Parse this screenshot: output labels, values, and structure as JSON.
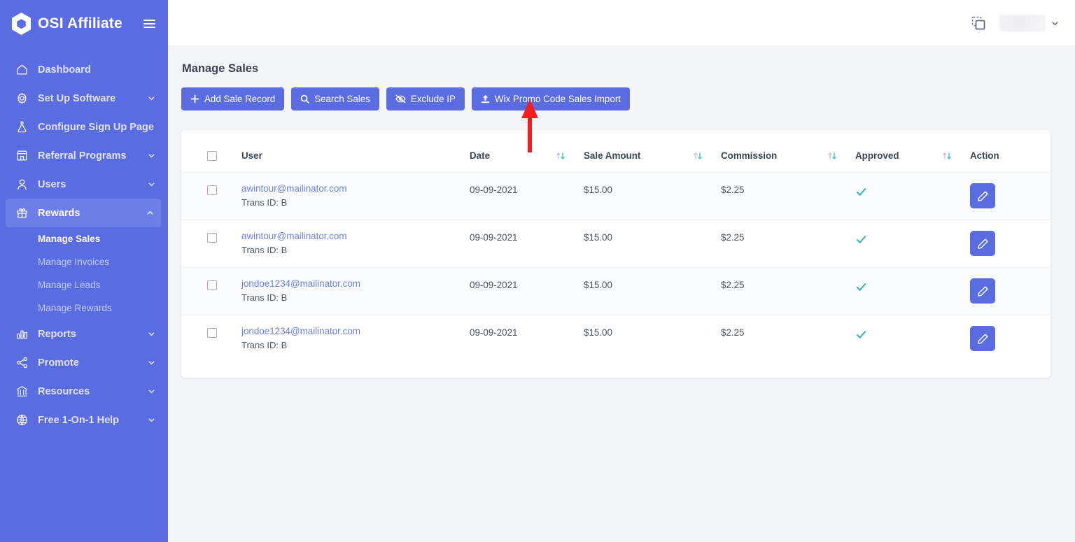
{
  "brand": {
    "name": "OSI Affiliate",
    "logo_icon": "hexagon-logo-icon",
    "menu_icon": "hamburger-menu-icon"
  },
  "sidebar": {
    "items": [
      {
        "label": "Dashboard",
        "icon": "home-icon",
        "expandable": false,
        "active": false
      },
      {
        "label": "Set Up Software",
        "icon": "gear-icon",
        "expandable": true,
        "active": false
      },
      {
        "label": "Configure Sign Up Page",
        "icon": "flask-icon",
        "expandable": false,
        "active": false
      },
      {
        "label": "Referral Programs",
        "icon": "store-icon",
        "expandable": true,
        "active": false
      },
      {
        "label": "Users",
        "icon": "person-icon",
        "expandable": true,
        "active": false
      },
      {
        "label": "Rewards",
        "icon": "gift-icon",
        "expandable": true,
        "active": true
      }
    ],
    "sub_items": [
      {
        "label": "Manage Sales",
        "current": true
      },
      {
        "label": "Manage Invoices",
        "current": false
      },
      {
        "label": "Manage Leads",
        "current": false
      },
      {
        "label": "Manage Rewards",
        "current": false
      }
    ],
    "items_after": [
      {
        "label": "Reports",
        "icon": "bar-chart-icon",
        "expandable": true
      },
      {
        "label": "Promote",
        "icon": "share-nodes-icon",
        "expandable": true
      },
      {
        "label": "Resources",
        "icon": "bank-icon",
        "expandable": true
      },
      {
        "label": "Free 1-On-1 Help",
        "icon": "globe-icon",
        "expandable": true
      }
    ]
  },
  "topbar": {
    "duplicate_icon": "copy-duplicate-icon",
    "avatar": "user-avatar",
    "chevron_icon": "chevron-down-icon"
  },
  "main": {
    "page_title": "Manage Sales",
    "toolbar": [
      {
        "label": "Add Sale Record",
        "icon": "plus-icon"
      },
      {
        "label": "Search Sales",
        "icon": "search-icon"
      },
      {
        "label": "Exclude IP",
        "icon": "eye-slash-icon"
      },
      {
        "label": "Wix Promo Code Sales Import",
        "icon": "upload-icon"
      }
    ],
    "table": {
      "columns": [
        {
          "label": "",
          "sortable": false
        },
        {
          "label": "User",
          "sortable": false
        },
        {
          "label": "Date",
          "sortable": true
        },
        {
          "label": "Sale Amount",
          "sortable": true
        },
        {
          "label": "Commission",
          "sortable": true
        },
        {
          "label": "Approved",
          "sortable": true
        },
        {
          "label": "Action",
          "sortable": false
        }
      ],
      "rows": [
        {
          "user": "awintour@mailinator.com",
          "trans": "Trans ID: B",
          "date": "09-09-2021",
          "amount": "$15.00",
          "commission": "$2.25",
          "approved": true,
          "action": "edit-button"
        },
        {
          "user": "awintour@mailinator.com",
          "trans": "Trans ID: B",
          "date": "09-09-2021",
          "amount": "$15.00",
          "commission": "$2.25",
          "approved": true,
          "action": "edit-button"
        },
        {
          "user": "jondoe1234@mailinator.com",
          "trans": "Trans ID: B",
          "date": "09-09-2021",
          "amount": "$15.00",
          "commission": "$2.25",
          "approved": true,
          "action": "edit-button"
        },
        {
          "user": "jondoe1234@mailinator.com",
          "trans": "Trans ID: B",
          "date": "09-09-2021",
          "amount": "$15.00",
          "commission": "$2.25",
          "approved": true,
          "action": "edit-button"
        }
      ]
    }
  },
  "annotation": {
    "type": "red-arrow-up",
    "color": "#f51d1d",
    "points_to": "Wix Promo Code Sales Import"
  },
  "colors": {
    "brand_blue": "#5a6ce0",
    "sidebar_bg": "#5a6ce0",
    "sidebar_active": "#6d7ee8",
    "page_bg": "#f4f5f8",
    "link": "#6f7fe4",
    "tick_teal": "#2bb3b5",
    "annotation_red": "#f51d1d"
  }
}
